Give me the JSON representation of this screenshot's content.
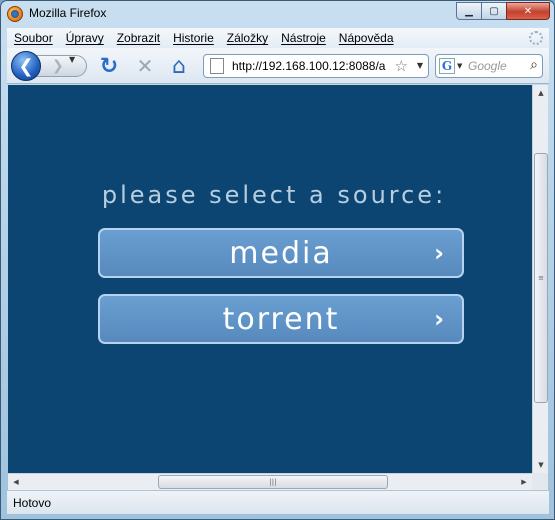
{
  "window": {
    "title": "Mozilla Firefox",
    "controls": {
      "minimize": "▁",
      "maximize": "▢",
      "close": "✕"
    }
  },
  "menu": [
    {
      "label": "Soubor"
    },
    {
      "label": "Úpravy"
    },
    {
      "label": "Zobrazit"
    },
    {
      "label": "Historie"
    },
    {
      "label": "Záložky"
    },
    {
      "label": "Nástroje"
    },
    {
      "label": "Nápověda"
    }
  ],
  "toolbar": {
    "back_glyph": "❮",
    "forward_glyph": "❯",
    "reload_glyph": "↻",
    "stop_glyph": "✕",
    "home_glyph": "⌂",
    "url": "http://192.168.100.12:8088/a",
    "star_glyph": "☆",
    "dropdown_glyph": "▼",
    "search_engine_glyph": "G",
    "search_placeholder": "Google",
    "search_go_glyph": "⌕"
  },
  "content": {
    "background": "#0c4572",
    "prompt": "please select a source:",
    "buttons": [
      {
        "label": "media",
        "chevron": "›"
      },
      {
        "label": "torrent",
        "chevron": "›"
      }
    ],
    "button_color": "#5c8fc3",
    "button_border": "#b6d2ee"
  },
  "scrollbars": {
    "up": "▲",
    "down": "▼",
    "left": "◀",
    "right": "▶",
    "grip": "≡",
    "hgrip": "|||"
  },
  "status": {
    "text": "Hotovo"
  }
}
